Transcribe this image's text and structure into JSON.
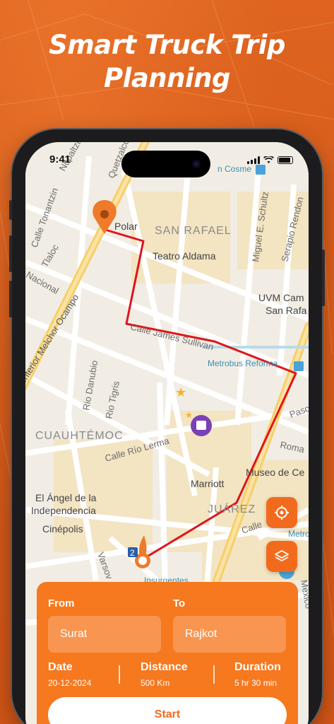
{
  "headline": {
    "line1": "Smart Truck Trip",
    "line2": "Planning"
  },
  "status_bar": {
    "time": "9:41"
  },
  "map": {
    "labels": {
      "nopaltzin": "Nopaltzin",
      "quetzalcoatl": "Quetzalcoa",
      "tonantzin": "Calle Tonantzin",
      "tlaloc": "Tlaloc",
      "nacional": "Nacional",
      "melchor": "Interior Melchor Ocampo",
      "polar": "Polar",
      "san_rafael": "SAN RAFAEL",
      "teatro": "Teatro Aldama",
      "schultz": "Miguel E. Schultz",
      "serapio": "Serapio Rendon",
      "uvm1": "UVM Cam",
      "uvm2": "San Rafa",
      "sullivan": "Calle James Sullivan",
      "metrobus": "Metrobus Reforma",
      "cosme": "n Cosme",
      "danubio": "Rio Danubio",
      "tigris": "Rio Tigris",
      "cuauhtemoc": "CUAUHTÉMOC",
      "lerma": "Calle Río Lerma",
      "pasco": "Pasc",
      "roma": "Roma",
      "museo": "Museo de Ce",
      "marriott": "Marriott",
      "angel1": "El Ángel de la",
      "angel2": "Independencia",
      "cinepolis": "Cinépolis",
      "juarez": "JUÁREZ",
      "calle": "Calle",
      "metro": "Metro",
      "insurgentes": "Insurgentes",
      "varsovia": "Varsov",
      "mexico": "Mexico",
      "badge_2": "2"
    }
  },
  "trip": {
    "from_label": "From",
    "to_label": "To",
    "from_value": "Surat",
    "to_value": "Rajkot",
    "date_label": "Date",
    "date_value": "20-12-2024",
    "distance_label": "Distance",
    "distance_value": "500 Km",
    "duration_label": "Duration",
    "duration_value": "5 hr 30 min",
    "start_label": "Start"
  },
  "colors": {
    "accent": "#f26b1d",
    "route": "#e0141b"
  }
}
